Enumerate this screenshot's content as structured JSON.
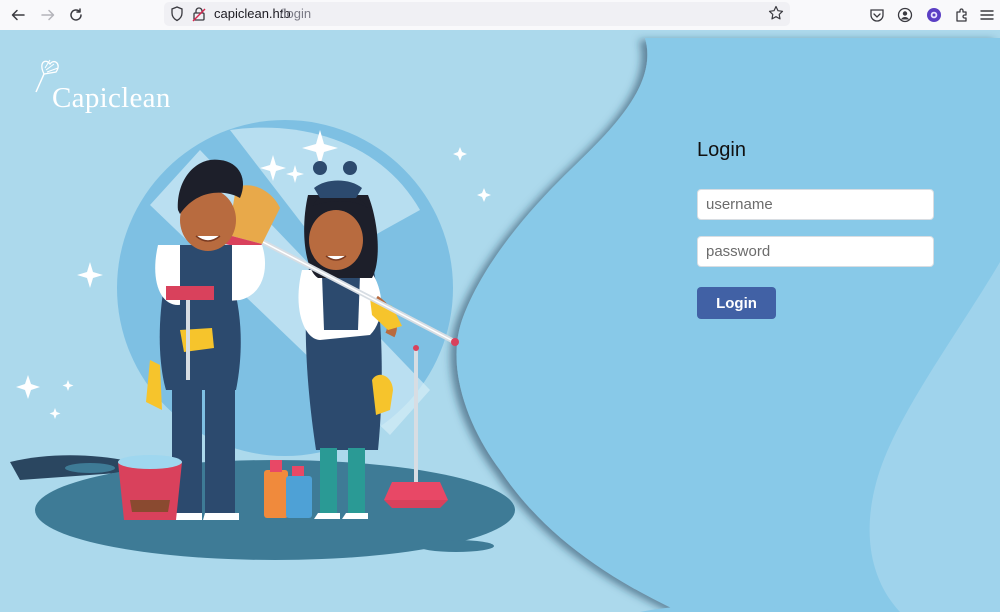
{
  "browser": {
    "url_host": "capiclean.htb",
    "url_path": "/login"
  },
  "page": {
    "brand": "Capiclean",
    "login": {
      "title": "Login",
      "username_placeholder": "username",
      "password_placeholder": "password",
      "button_label": "Login"
    }
  },
  "colors": {
    "page_background": "#acd9ec",
    "panel": "#88c9e8",
    "button": "#4161a5"
  },
  "icons": [
    "back-icon",
    "forward-icon",
    "reload-icon",
    "shield-icon",
    "lock-icon",
    "star-icon",
    "pocket-icon",
    "account-icon",
    "extension-icon",
    "puzzle-icon",
    "menu-icon"
  ]
}
